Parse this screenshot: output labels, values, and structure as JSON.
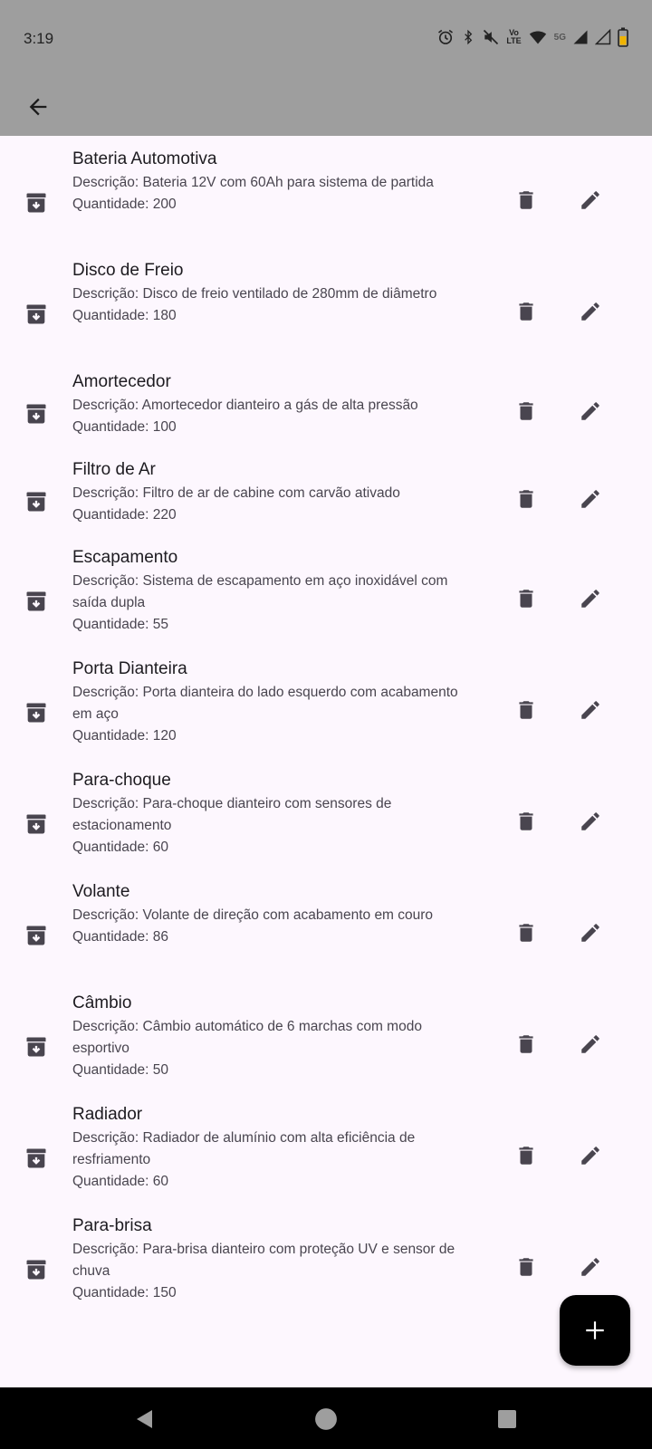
{
  "status_bar": {
    "time": "3:19",
    "volte_top": "Vo",
    "volte_bottom": "LTE",
    "network": "5G"
  },
  "app_bar": {
    "back_icon": "arrow-back-icon"
  },
  "items": [
    {
      "name": "Bateria Automotiva",
      "description": "Descrição: Bateria 12V com 60Ah para sistema de partida",
      "quantity": "Quantidade: 200"
    },
    {
      "name": "Disco de Freio",
      "description": "Descrição: Disco de freio ventilado de 280mm de diâmetro",
      "quantity": "Quantidade: 180"
    },
    {
      "name": "Amortecedor",
      "description": "Descrição: Amortecedor dianteiro a gás de alta pressão",
      "quantity": "Quantidade: 100"
    },
    {
      "name": "Filtro de Ar",
      "description": "Descrição: Filtro de ar de cabine com carvão ativado",
      "quantity": "Quantidade: 220"
    },
    {
      "name": "Escapamento",
      "description": "Descrição: Sistema de escapamento em aço inoxidável com saída dupla",
      "quantity": "Quantidade: 55"
    },
    {
      "name": "Porta Dianteira",
      "description": "Descrição: Porta dianteira do lado esquerdo com acabamento em aço",
      "quantity": "Quantidade: 120"
    },
    {
      "name": "Para-choque",
      "description": "Descrição: Para-choque dianteiro com sensores de estacionamento",
      "quantity": "Quantidade: 60"
    },
    {
      "name": "Volante",
      "description": "Descrição: Volante de direção com acabamento em couro",
      "quantity": "Quantidade: 86"
    },
    {
      "name": "Câmbio",
      "description": "Descrição: Câmbio automático de 6 marchas com modo esportivo",
      "quantity": "Quantidade: 50"
    },
    {
      "name": "Radiador",
      "description": "Descrição: Radiador de alumínio com alta eficiência de resfriamento",
      "quantity": "Quantidade: 60"
    },
    {
      "name": "Para-brisa",
      "description": "Descrição: Para-brisa dianteiro com proteção UV e sensor de chuva",
      "quantity": "Quantidade: 150"
    }
  ],
  "icons": {
    "leading": "archive-icon",
    "delete": "trash-icon",
    "edit": "pencil-icon",
    "fab": "plus-icon"
  },
  "colors": {
    "app_bar": "#9e9e9e",
    "background": "#fdf7fe",
    "fab": "#000000",
    "icon": "#49454f"
  }
}
